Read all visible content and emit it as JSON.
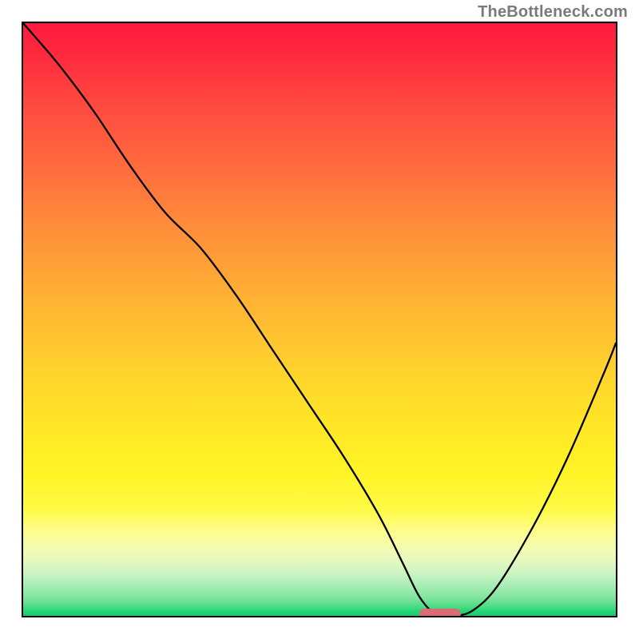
{
  "watermark": "TheBottleneck.com",
  "chart_data": {
    "type": "line",
    "title": "",
    "xlabel": "",
    "ylabel": "",
    "xlim": [
      0,
      100
    ],
    "ylim": [
      0,
      100
    ],
    "series": [
      {
        "name": "bottleneck-curve",
        "x": [
          0,
          6,
          12,
          18,
          24,
          30,
          36,
          42,
          48,
          54,
          60,
          64,
          67,
          70,
          73,
          76,
          80,
          86,
          92,
          98,
          100
        ],
        "values": [
          100,
          93,
          85,
          76,
          68,
          62,
          54,
          45,
          36,
          27,
          17,
          9,
          3,
          0,
          0,
          1,
          5,
          15,
          27,
          41,
          46
        ]
      }
    ],
    "optimal_marker": {
      "x_start": 67,
      "x_end": 74,
      "y": 0
    },
    "background": {
      "type": "vertical-gradient",
      "stops": [
        {
          "pct": 0,
          "color": "#ff1a3d"
        },
        {
          "pct": 50,
          "color": "#ffc12f"
        },
        {
          "pct": 80,
          "color": "#fff83a"
        },
        {
          "pct": 100,
          "color": "#10d36e"
        }
      ]
    }
  }
}
